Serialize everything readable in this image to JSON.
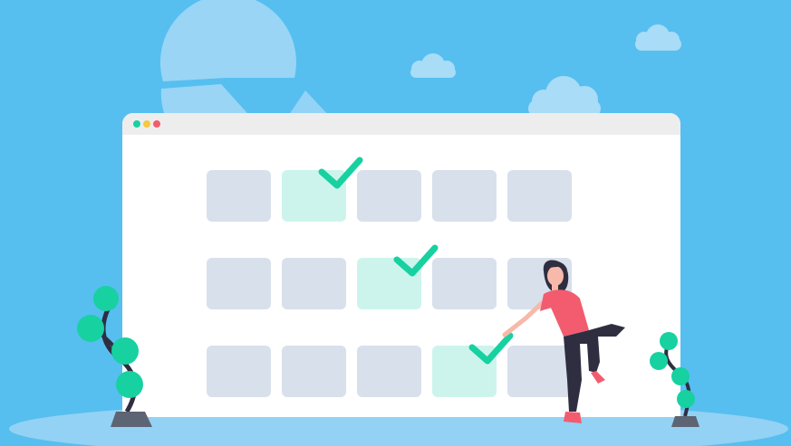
{
  "illustration": {
    "colors": {
      "sky": "#56bff0",
      "sky_light": "#93d2f4",
      "cloud": "#a9dcf6",
      "window_bg": "#ffffff",
      "title_bar": "#ededed",
      "cell_empty": "#d8e0ec",
      "cell_done": "#cdf4ec",
      "check": "#17d1a0",
      "dot_green": "#17d1a0",
      "dot_yellow": "#f6c83e",
      "dot_red": "#f25c6e",
      "shirt": "#f25c6e",
      "pants": "#2f2e41",
      "hair": "#2f2e41",
      "skin": "#f7b9a9",
      "plant_leaf": "#17d1a0",
      "plant_stem": "#2f2e41",
      "pot": "#5d6473"
    },
    "calendar": {
      "rows": [
        [
          "empty",
          "done",
          "empty",
          "empty",
          "empty"
        ],
        [
          "empty",
          "empty",
          "done",
          "empty",
          "empty"
        ],
        [
          "empty",
          "empty",
          "empty",
          "done",
          "empty"
        ]
      ]
    },
    "icons": [
      "check-icon",
      "window-dot-icon",
      "cloud-icon",
      "pie-icon",
      "plant-icon",
      "woman-figure"
    ]
  }
}
